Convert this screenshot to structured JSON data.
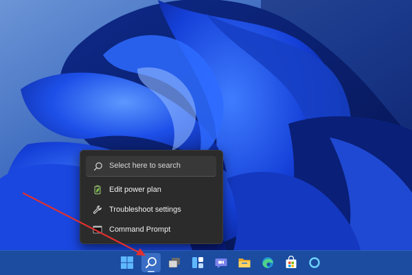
{
  "search_popup": {
    "search_placeholder": "Select here to search",
    "items": [
      {
        "label": "Edit power plan",
        "icon": "battery-leaf-icon"
      },
      {
        "label": "Troubleshoot settings",
        "icon": "wrench-icon"
      },
      {
        "label": "Command Prompt",
        "icon": "command-prompt-icon"
      }
    ]
  },
  "taskbar": {
    "buttons": [
      {
        "name": "start-button",
        "icon": "windows-logo-icon"
      },
      {
        "name": "search-button",
        "icon": "search-icon",
        "active": true
      },
      {
        "name": "task-view-button",
        "icon": "task-view-icon"
      },
      {
        "name": "widgets-button",
        "icon": "widgets-icon"
      },
      {
        "name": "teams-chat-button",
        "icon": "teams-chat-icon"
      },
      {
        "name": "file-explorer-button",
        "icon": "folder-icon"
      },
      {
        "name": "edge-button",
        "icon": "edge-browser-icon"
      },
      {
        "name": "store-button",
        "icon": "microsoft-store-icon"
      },
      {
        "name": "cortana-button",
        "icon": "cortana-icon"
      }
    ]
  },
  "colors": {
    "taskbar": "#1b4c9f",
    "popup": "#2b2b2b",
    "annotation_arrow": "#e03030"
  }
}
